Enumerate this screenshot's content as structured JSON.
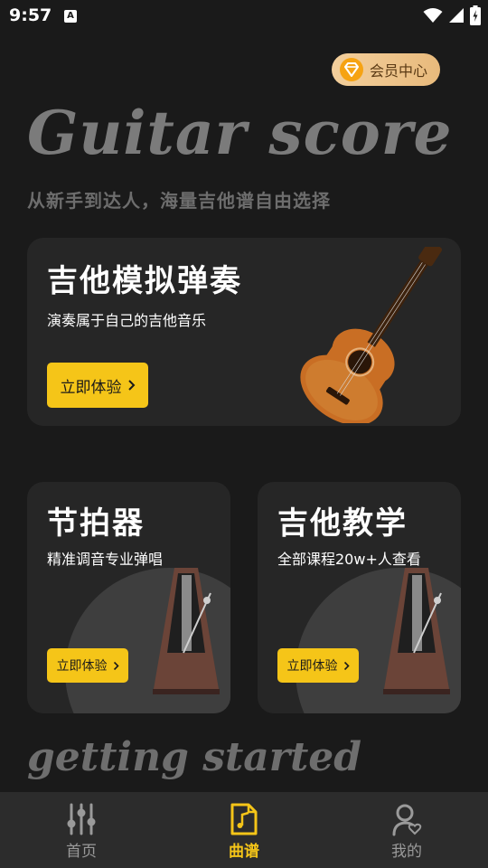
{
  "status": {
    "time": "9:57",
    "notification_glyph": "A"
  },
  "vip": {
    "label": "会员中心",
    "icon": "diamond-icon"
  },
  "hero": {
    "title": "Guitar score",
    "subtitle": "从新手到达人，海量吉他谱自由选择"
  },
  "main_card": {
    "title": "吉他模拟弹奏",
    "desc": "演奏属于自己的吉他音乐",
    "button": "立即体验",
    "image": "guitar"
  },
  "cards": [
    {
      "title": "节拍器",
      "desc": "精准调音专业弹唱",
      "button": "立即体验",
      "image": "metronome"
    },
    {
      "title": "吉他教学",
      "desc": "全部课程20w+人查看",
      "button": "立即体验",
      "image": "metronome"
    }
  ],
  "getting_started": "getting started",
  "nav": {
    "items": [
      {
        "label": "首页",
        "icon": "sliders-icon"
      },
      {
        "label": "曲谱",
        "icon": "music-doc-icon"
      },
      {
        "label": "我的",
        "icon": "user-heart-icon"
      }
    ],
    "active_index": 1
  },
  "colors": {
    "accent": "#f5c518",
    "card_bg": "#262626",
    "page_bg": "#1a1a1a",
    "vip_bg": "#efc68d"
  }
}
